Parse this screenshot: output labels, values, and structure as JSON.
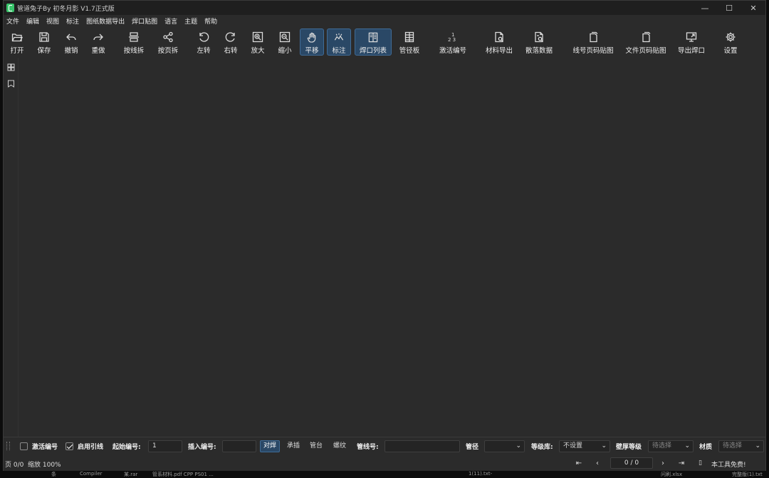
{
  "window": {
    "title": "管道兔子By 初冬月影 V1.7正式版",
    "controls": {
      "minimize": "—",
      "maximize": "☐",
      "close": "✕"
    }
  },
  "menu": [
    "文件",
    "编辑",
    "视图",
    "标注",
    "图纸数据导出",
    "焊口贴图",
    "语言",
    "主题",
    "帮助"
  ],
  "toolbar": [
    {
      "label": "打开",
      "icon": "folder-open-icon"
    },
    {
      "label": "保存",
      "icon": "save-icon"
    },
    {
      "label": "撤销",
      "icon": "undo-icon"
    },
    {
      "label": "重做",
      "icon": "redo-icon"
    },
    {
      "label": "按线拆",
      "icon": "split-by-line-icon"
    },
    {
      "label": "按页拆",
      "icon": "split-by-page-icon"
    },
    {
      "label": "左转",
      "icon": "rotate-left-icon"
    },
    {
      "label": "右转",
      "icon": "rotate-right-icon"
    },
    {
      "label": "放大",
      "icon": "zoom-in-icon"
    },
    {
      "label": "缩小",
      "icon": "zoom-out-icon"
    },
    {
      "label": "平移",
      "icon": "hand-icon",
      "active": true
    },
    {
      "label": "标注",
      "icon": "annotate-icon",
      "active": true
    },
    {
      "label": "焊口列表",
      "icon": "list-icon",
      "active": true
    },
    {
      "label": "管径板",
      "icon": "panel-icon"
    },
    {
      "label": "激活编号",
      "icon": "numbering-icon"
    },
    {
      "label": "材料导出",
      "icon": "material-export-icon"
    },
    {
      "label": "散落数据",
      "icon": "scatter-data-icon"
    },
    {
      "label": "线号页码贴图",
      "icon": "line-page-stamp-icon"
    },
    {
      "label": "文件页码贴图",
      "icon": "file-page-stamp-icon"
    },
    {
      "label": "导出焊口",
      "icon": "export-weld-icon"
    },
    {
      "label": "设置",
      "icon": "gear-icon"
    }
  ],
  "bottom": {
    "activate_numbering": {
      "label": "激活编号",
      "checked": false
    },
    "enable_leader": {
      "label": "启用引线",
      "checked": true
    },
    "start_number": {
      "label": "起始编号:",
      "value": "1"
    },
    "insert_number": {
      "label": "插入编号:",
      "value": ""
    },
    "weld_types": [
      {
        "label": "对焊",
        "active": true
      },
      {
        "label": "承插",
        "active": false
      },
      {
        "label": "管台",
        "active": false
      },
      {
        "label": "螺纹",
        "active": false
      }
    ],
    "pipeline_number": {
      "label": "管线号:",
      "value": ""
    },
    "pipe_diameter": {
      "label": "管径",
      "value": ""
    },
    "grade_library": {
      "label": "等级库:",
      "value": "不设置"
    },
    "wall_grade": {
      "label": "壁厚等级",
      "placeholder": "待选择"
    },
    "material": {
      "label": "材质",
      "placeholder": "待选择"
    }
  },
  "status": {
    "page": "页 0/0",
    "zoom": "缩放 100%",
    "page_input": "0 / 0",
    "free_notice": "本工具免费!"
  },
  "desktop_fragments": [
    "条",
    "Compiler",
    "某.rar",
    "管系材料.pdf  CPP PS01 ...",
    "1(11).txt-",
    "问刷.xlsx",
    "完整版(1).txt"
  ]
}
